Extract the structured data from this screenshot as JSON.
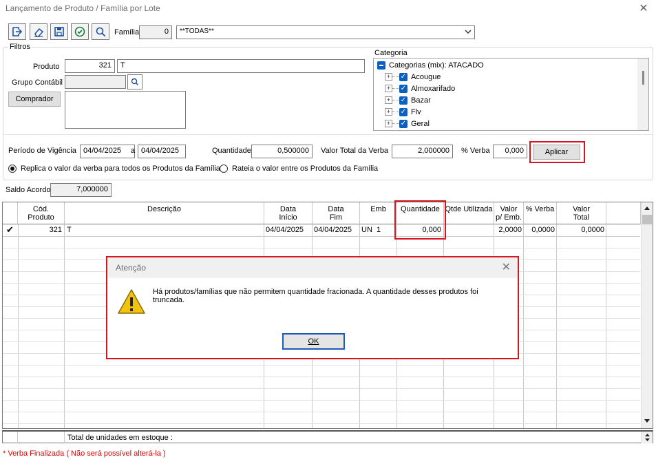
{
  "window": {
    "title": "Lançamento de Produto / Família por Lote",
    "close": "✕"
  },
  "toolbar": {
    "familia_label": "Família",
    "familia_code": "0",
    "familia_select": "**TODAS**"
  },
  "filtros": {
    "label": "Filtros",
    "produto_label": "Produto",
    "produto_code": "321",
    "produto_desc": "T",
    "grupo_label": "Grupo Contábil",
    "comprador_button": "Comprador"
  },
  "categoria": {
    "label": "Categoria",
    "root": "Categorias (mix): ATACADO",
    "items": [
      "Acougue",
      "Almoxarifado",
      "Bazar",
      "Flv",
      "Geral"
    ]
  },
  "vigencia": {
    "periodo_label": "Período de Vigência",
    "date_from": "04/04/2025",
    "a_label": "a",
    "date_to": "04/04/2025",
    "quantidade_label": "Quantidade",
    "quantidade": "0,500000",
    "valor_total_label": "Valor Total da Verba",
    "valor_total": "2,000000",
    "pct_verba_label": "% Verba",
    "pct_verba": "0,000",
    "aplicar": "Aplicar",
    "radio1": "Replica o valor da verba para todos os Produtos da Família",
    "radio2": "Rateia o valor entre os Produtos da Família"
  },
  "saldo": {
    "label": "Saldo Acordo",
    "value": "7,000000"
  },
  "grid": {
    "headers": [
      "Cód.\nProduto",
      "Descrição",
      "Data\nInício",
      "Data\nFim",
      "Emb",
      "Quantidade",
      "Qtde Utilizada",
      "Valor\np/ Emb.",
      "% Verba",
      "Valor\nTotal"
    ],
    "row": {
      "check": "✔",
      "cod": "321",
      "descricao": "T",
      "data_inicio": "04/04/2025",
      "data_fim": "04/04/2025",
      "emb": "UN  1",
      "quantidade": "0,000",
      "valor_emb": "2,0000",
      "pct_verba": "0,0000",
      "valor_total": "0,0000"
    }
  },
  "footer": {
    "total_label": "Total de unidades em estoque  :",
    "note": "* Verba Finalizada ( Não será possível alterá-la )"
  },
  "dialog": {
    "title": "Atenção",
    "message": "Há produtos/famílias que não permitem quantidade fracionada. A quantidade desses produtos foi truncada.",
    "ok": "OK"
  },
  "colors": {
    "accent_red": "#d9141e",
    "check_blue": "#0a5fbf",
    "note_red": "#e00000"
  }
}
